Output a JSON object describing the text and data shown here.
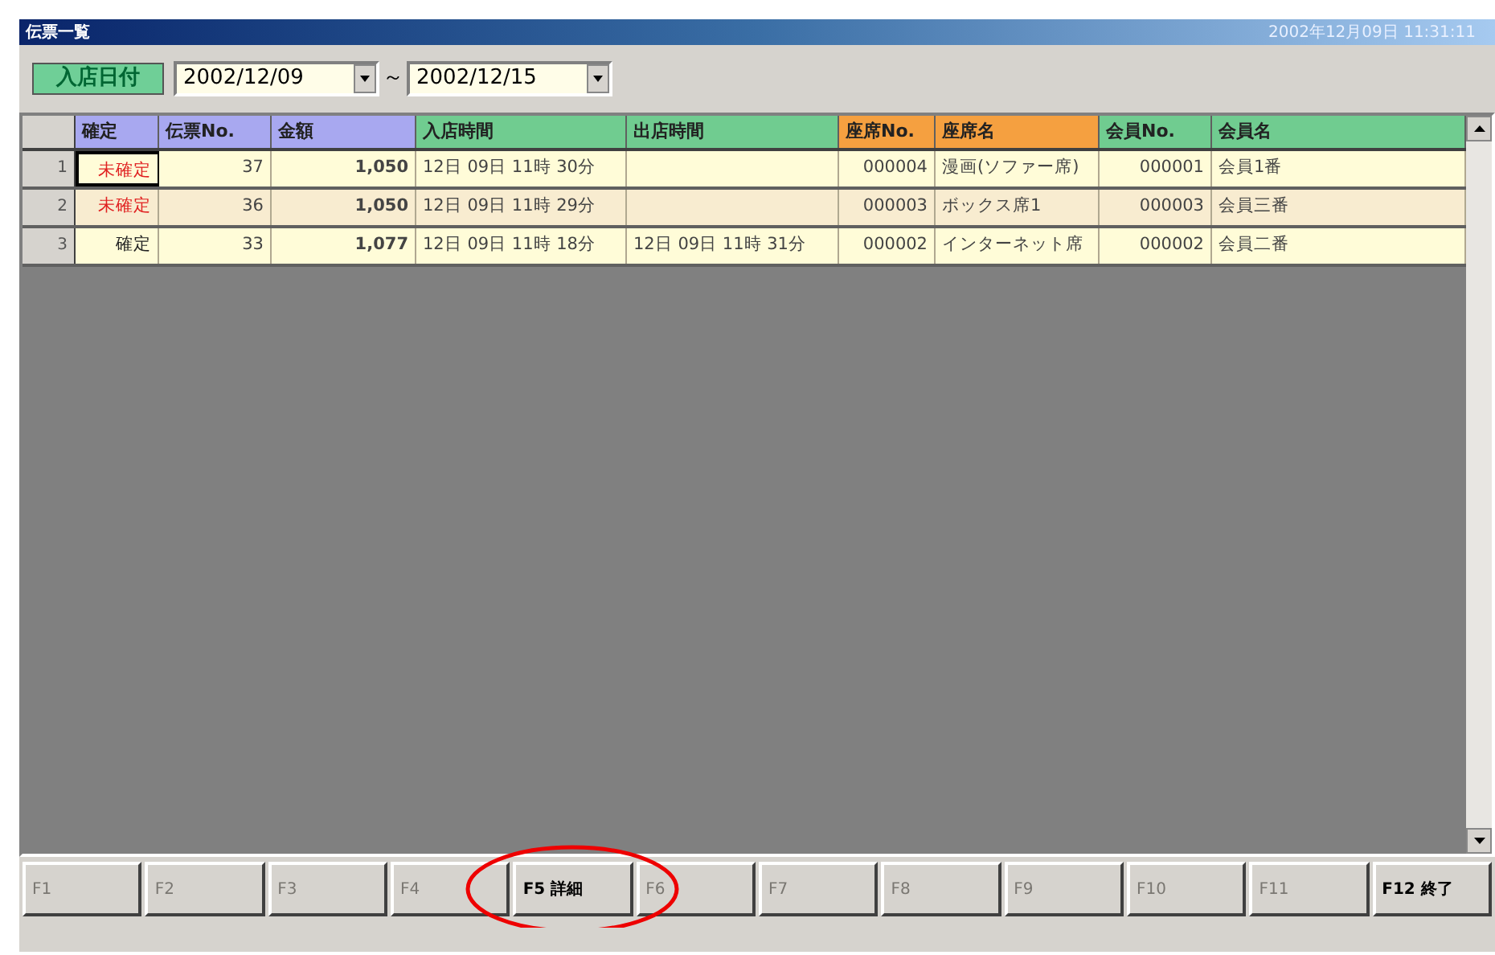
{
  "window": {
    "title": "伝票一覧",
    "clock": "2002年12月09日 11:31:11"
  },
  "filter": {
    "label": "入店日付",
    "from": "2002/12/09",
    "separator": "～",
    "to": "2002/12/15"
  },
  "table": {
    "columns": [
      {
        "label": "確定",
        "color": "#a8a8f0"
      },
      {
        "label": "伝票No.",
        "color": "#a8a8f0"
      },
      {
        "label": "金額",
        "color": "#a8a8f0"
      },
      {
        "label": "入店時間",
        "color": "#70cc90"
      },
      {
        "label": "出店時間",
        "color": "#70cc90"
      },
      {
        "label": "座席No.",
        "color": "#f5a040"
      },
      {
        "label": "座席名",
        "color": "#f5a040"
      },
      {
        "label": "会員No.",
        "color": "#70cc90"
      },
      {
        "label": "会員名",
        "color": "#70cc90"
      }
    ],
    "rows": [
      {
        "number": "1",
        "selected": true,
        "confirmed": false,
        "cells": [
          "未確定",
          "37",
          "1,050",
          "12日 09日 11時 30分",
          "",
          "000004",
          "漫画(ソファー席)",
          "000001",
          "会員1番"
        ]
      },
      {
        "number": "2",
        "selected": false,
        "confirmed": false,
        "cells": [
          "未確定",
          "36",
          "1,050",
          "12日 09日 11時 29分",
          "",
          "000003",
          "ボックス席1",
          "000003",
          "会員三番"
        ]
      },
      {
        "number": "3",
        "selected": false,
        "confirmed": true,
        "cells": [
          "確定",
          "33",
          "1,077",
          "12日 09日 11時 18分",
          "12日 09日 11時 31分",
          "000002",
          "インターネット席",
          "000002",
          "会員二番"
        ]
      }
    ]
  },
  "function_keys": [
    {
      "label": "F1",
      "disabled": true
    },
    {
      "label": "F2",
      "disabled": true
    },
    {
      "label": "F3",
      "disabled": true
    },
    {
      "label": "F4",
      "disabled": true
    },
    {
      "label": "F5 詳細",
      "disabled": false,
      "highlighted": true
    },
    {
      "label": "F6",
      "disabled": true
    },
    {
      "label": "F7",
      "disabled": true
    },
    {
      "label": "F8",
      "disabled": true
    },
    {
      "label": "F9",
      "disabled": true
    },
    {
      "label": "F10",
      "disabled": true
    },
    {
      "label": "F11",
      "disabled": true
    },
    {
      "label": "F12 終了",
      "disabled": false
    }
  ]
}
